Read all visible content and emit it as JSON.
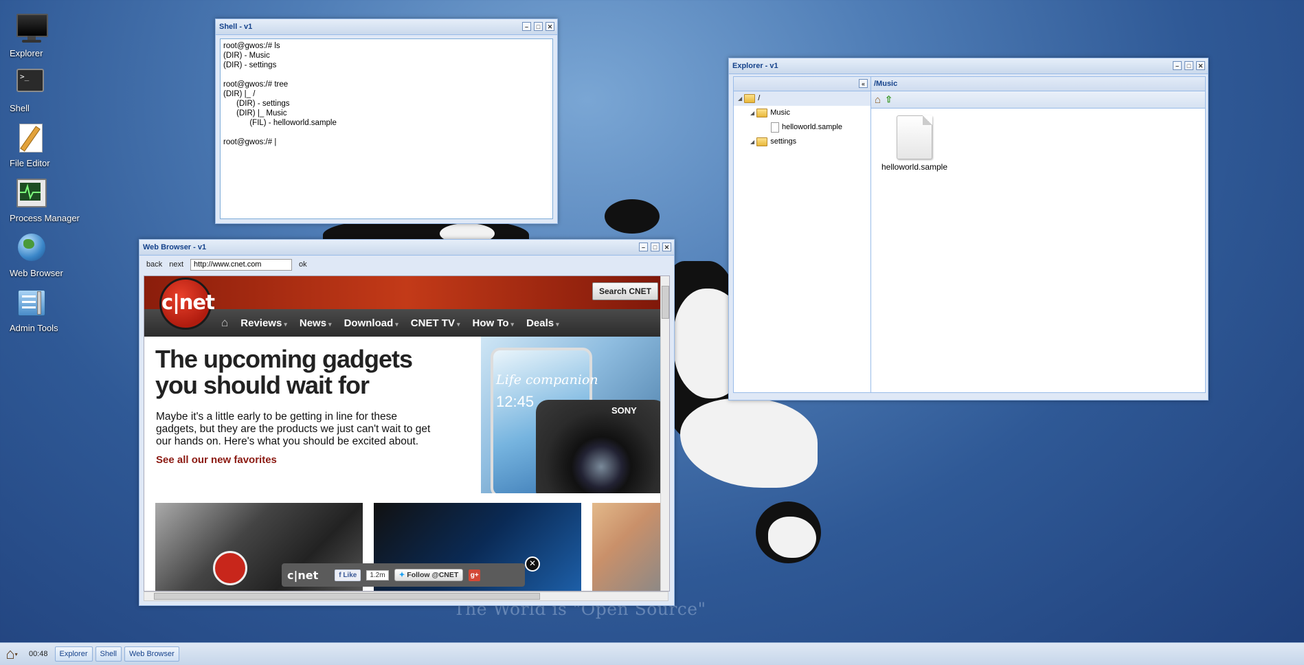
{
  "desktop": {
    "icons": [
      {
        "label": "Explorer"
      },
      {
        "label": "Shell"
      },
      {
        "label": "File Editor"
      },
      {
        "label": "Process Manager"
      },
      {
        "label": "Web Browser"
      },
      {
        "label": "Admin Tools"
      }
    ],
    "tagline": "The World is \"Open Source\""
  },
  "shell": {
    "title": "Shell - v1",
    "content": "root@gwos:/# ls\n(DIR) - Music\n(DIR) - settings\n\nroot@gwos:/# tree\n(DIR) |_ /\n      (DIR) - settings\n      (DIR) |_ Music\n            (FIL) - helloworld.sample\n\nroot@gwos:/# |"
  },
  "browser": {
    "title": "Web Browser - v1",
    "back_label": "back",
    "next_label": "next",
    "url": "http://www.cnet.com",
    "ok_label": "ok",
    "page": {
      "logo": "c|net",
      "search_label": "Search CNET",
      "nav": [
        "Reviews",
        "News",
        "Download",
        "CNET TV",
        "How To",
        "Deals"
      ],
      "headline": "The upcoming gadgets you should wait for",
      "description": "Maybe it's a little early to be getting in line for these gadgets, but they are the products we just can't wait to get our hands on. Here's what you should be excited about.",
      "link": "See all our new favorites",
      "hero_text": "Life companion",
      "hero_time": "12:45",
      "hero_brand": "SONY",
      "share": {
        "logo": "c|net",
        "like_label": "Like",
        "like_count": "1.2m",
        "follow_label": "Follow @CNET",
        "gplus": "g+"
      }
    }
  },
  "explorer": {
    "title": "Explorer - v1",
    "path": "/Music",
    "tree": [
      {
        "label": "/",
        "type": "folder",
        "depth": 0
      },
      {
        "label": "Music",
        "type": "folder",
        "depth": 1
      },
      {
        "label": "helloworld.sample",
        "type": "file",
        "depth": 2
      },
      {
        "label": "settings",
        "type": "folder",
        "depth": 1
      }
    ],
    "files": [
      {
        "name": "helloworld.sample"
      }
    ]
  },
  "taskbar": {
    "clock": "00:48",
    "tasks": [
      "Explorer",
      "Shell",
      "Web Browser"
    ]
  }
}
